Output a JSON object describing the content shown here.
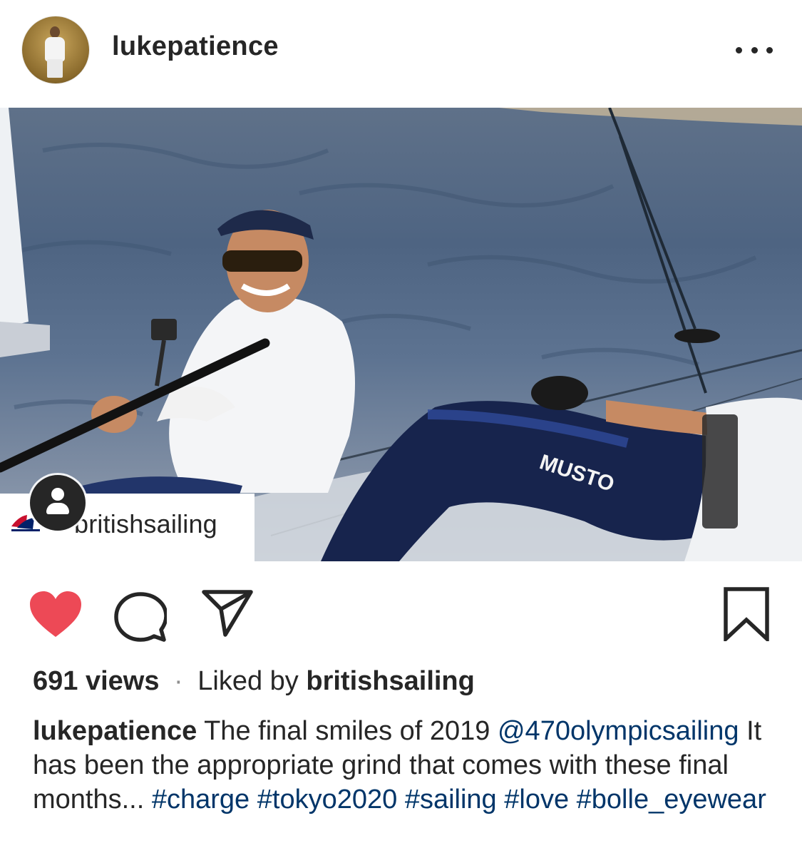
{
  "post": {
    "username": "lukepatience",
    "more_icon": "more-horizontal-icon",
    "media": {
      "description_icon": "video-thumbnail",
      "tagged_user": "britishsailing",
      "tag_icon": "user-tag-icon",
      "brand_text": "MUSTO"
    },
    "actions": {
      "like_icon": "heart-filled-icon",
      "like_color": "#ed4956",
      "comment_icon": "comment-icon",
      "share_icon": "share-icon",
      "save_icon": "bookmark-icon"
    },
    "stats": {
      "views": "691 views",
      "separator": "·",
      "liked_by_prefix": "Liked by",
      "liked_by_user": "britishsailing"
    },
    "caption": {
      "user": "lukepatience",
      "text1": "The final smiles of 2019",
      "mention": "@470olympicsailing",
      "text2": "It has been the appropriate grind that comes with these final months...",
      "hashtags": [
        "#charge",
        "#tokyo2020",
        "#sailing",
        "#love",
        "#bolle_eyewear"
      ],
      "link_color": "#003569"
    }
  }
}
